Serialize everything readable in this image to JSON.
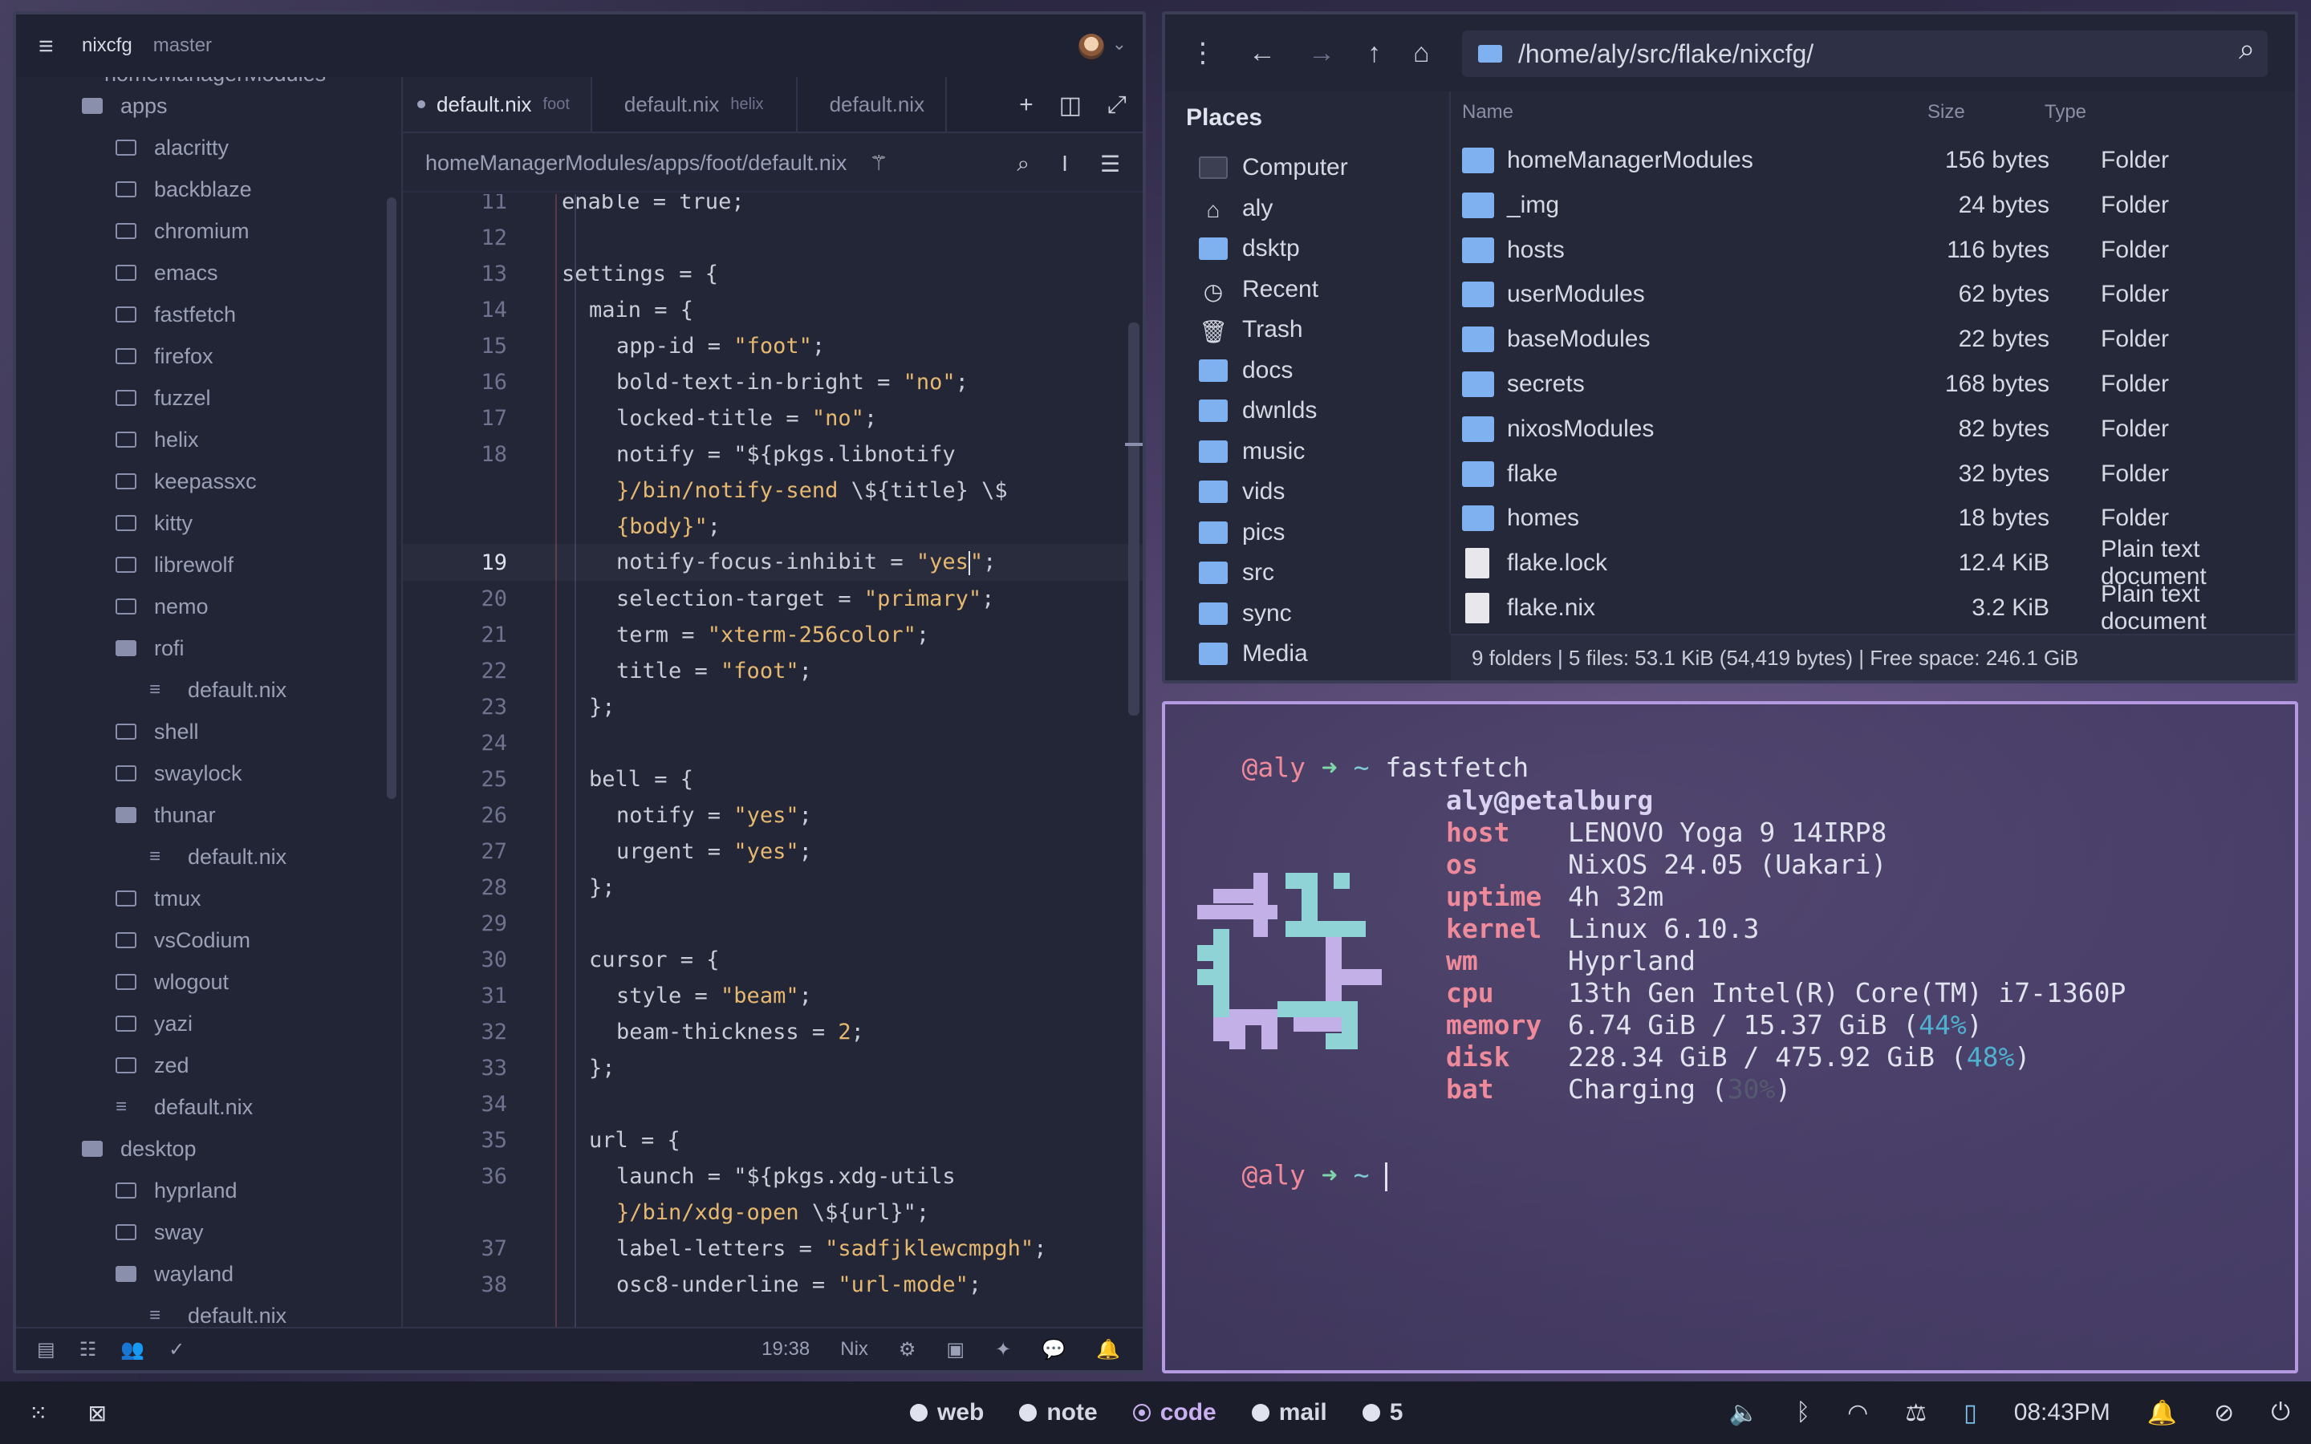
{
  "editor": {
    "project": "nixcfg",
    "branch": "master",
    "tabs": [
      {
        "label": "default.nix",
        "hint": "foot",
        "active": true
      },
      {
        "label": "default.nix",
        "hint": "helix",
        "active": false
      },
      {
        "label": "default.nix",
        "hint": "",
        "active": false
      }
    ],
    "breadcrumb": "homeManagerModules/apps/foot/default.nix",
    "sidebar": {
      "top_partial": "homeManagerModules",
      "items": [
        {
          "label": "apps",
          "kind": "folder-open",
          "depth": 1
        },
        {
          "label": "alacritty",
          "kind": "folder",
          "depth": 2
        },
        {
          "label": "backblaze",
          "kind": "folder",
          "depth": 2
        },
        {
          "label": "chromium",
          "kind": "folder",
          "depth": 2
        },
        {
          "label": "emacs",
          "kind": "folder",
          "depth": 2
        },
        {
          "label": "fastfetch",
          "kind": "folder",
          "depth": 2
        },
        {
          "label": "firefox",
          "kind": "folder",
          "depth": 2
        },
        {
          "label": "fuzzel",
          "kind": "folder",
          "depth": 2
        },
        {
          "label": "helix",
          "kind": "folder",
          "depth": 2
        },
        {
          "label": "keepassxc",
          "kind": "folder",
          "depth": 2
        },
        {
          "label": "kitty",
          "kind": "folder",
          "depth": 2
        },
        {
          "label": "librewolf",
          "kind": "folder",
          "depth": 2
        },
        {
          "label": "nemo",
          "kind": "folder",
          "depth": 2
        },
        {
          "label": "rofi",
          "kind": "folder-open",
          "depth": 2
        },
        {
          "label": "default.nix",
          "kind": "file",
          "depth": 3
        },
        {
          "label": "shell",
          "kind": "folder",
          "depth": 2
        },
        {
          "label": "swaylock",
          "kind": "folder",
          "depth": 2
        },
        {
          "label": "thunar",
          "kind": "folder-open",
          "depth": 2
        },
        {
          "label": "default.nix",
          "kind": "file",
          "depth": 3
        },
        {
          "label": "tmux",
          "kind": "folder",
          "depth": 2
        },
        {
          "label": "vsCodium",
          "kind": "folder",
          "depth": 2
        },
        {
          "label": "wlogout",
          "kind": "folder",
          "depth": 2
        },
        {
          "label": "yazi",
          "kind": "folder",
          "depth": 2
        },
        {
          "label": "zed",
          "kind": "folder",
          "depth": 2
        },
        {
          "label": "default.nix",
          "kind": "file",
          "depth": 2
        },
        {
          "label": "desktop",
          "kind": "folder-open",
          "depth": 1
        },
        {
          "label": "hyprland",
          "kind": "folder",
          "depth": 2
        },
        {
          "label": "sway",
          "kind": "folder",
          "depth": 2
        },
        {
          "label": "wayland",
          "kind": "folder-open",
          "depth": 2
        },
        {
          "label": "default.nix",
          "kind": "file",
          "depth": 3
        }
      ]
    },
    "code": [
      {
        "ln": "11",
        "text": "enable = true;",
        "indent": 2
      },
      {
        "ln": "12",
        "text": "",
        "indent": 0
      },
      {
        "ln": "13",
        "text": "settings = {",
        "indent": 2
      },
      {
        "ln": "14",
        "text": "main = {",
        "indent": 3
      },
      {
        "ln": "15",
        "parts": [
          [
            "app-id = ",
            ""
          ],
          [
            "\"foot\"",
            "str"
          ],
          [
            ";",
            ""
          ]
        ],
        "indent": 4
      },
      {
        "ln": "16",
        "parts": [
          [
            "bold-text-in-bright = ",
            ""
          ],
          [
            "\"no\"",
            "str"
          ],
          [
            ";",
            ""
          ]
        ],
        "indent": 4
      },
      {
        "ln": "17",
        "parts": [
          [
            "locked-title = ",
            ""
          ],
          [
            "\"no\"",
            "str"
          ],
          [
            ";",
            ""
          ]
        ],
        "indent": 4
      },
      {
        "ln": "18",
        "parts": [
          [
            "notify = \"${pkgs.libnotify",
            ""
          ]
        ],
        "indent": 4
      },
      {
        "ln": "",
        "parts": [
          [
            "}/bin/notify-send ",
            "str"
          ],
          [
            "\\${title} \\$",
            ""
          ]
        ],
        "indent": 4
      },
      {
        "ln": "",
        "parts": [
          [
            "{body}\"",
            "str"
          ],
          [
            ";",
            ""
          ]
        ],
        "indent": 4
      },
      {
        "ln": "19",
        "parts": [
          [
            "notify-focus-inhibit = ",
            ""
          ],
          [
            "\"yes",
            "str"
          ],
          [
            "|",
            "caret"
          ],
          [
            "\"",
            "str"
          ],
          [
            ";",
            ""
          ]
        ],
        "indent": 4,
        "current": true
      },
      {
        "ln": "20",
        "parts": [
          [
            "selection-target = ",
            ""
          ],
          [
            "\"primary\"",
            "str"
          ],
          [
            ";",
            ""
          ]
        ],
        "indent": 4
      },
      {
        "ln": "21",
        "parts": [
          [
            "term = ",
            ""
          ],
          [
            "\"xterm-256color\"",
            "str"
          ],
          [
            ";",
            ""
          ]
        ],
        "indent": 4
      },
      {
        "ln": "22",
        "parts": [
          [
            "title = ",
            ""
          ],
          [
            "\"foot\"",
            "str"
          ],
          [
            ";",
            ""
          ]
        ],
        "indent": 4
      },
      {
        "ln": "23",
        "text": "};",
        "indent": 3
      },
      {
        "ln": "24",
        "text": "",
        "indent": 0
      },
      {
        "ln": "25",
        "text": "bell = {",
        "indent": 3
      },
      {
        "ln": "26",
        "parts": [
          [
            "notify = ",
            ""
          ],
          [
            "\"yes\"",
            "str"
          ],
          [
            ";",
            ""
          ]
        ],
        "indent": 4
      },
      {
        "ln": "27",
        "parts": [
          [
            "urgent = ",
            ""
          ],
          [
            "\"yes\"",
            "str"
          ],
          [
            ";",
            ""
          ]
        ],
        "indent": 4
      },
      {
        "ln": "28",
        "text": "};",
        "indent": 3
      },
      {
        "ln": "29",
        "text": "",
        "indent": 0
      },
      {
        "ln": "30",
        "text": "cursor = {",
        "indent": 3
      },
      {
        "ln": "31",
        "parts": [
          [
            "style = ",
            ""
          ],
          [
            "\"beam\"",
            "str"
          ],
          [
            ";",
            ""
          ]
        ],
        "indent": 4
      },
      {
        "ln": "32",
        "parts": [
          [
            "beam-thickness = ",
            ""
          ],
          [
            "2",
            "num"
          ],
          [
            ";",
            ""
          ]
        ],
        "indent": 4
      },
      {
        "ln": "33",
        "text": "};",
        "indent": 3
      },
      {
        "ln": "34",
        "text": "",
        "indent": 0
      },
      {
        "ln": "35",
        "text": "url = {",
        "indent": 3
      },
      {
        "ln": "36",
        "parts": [
          [
            "launch = \"${pkgs.xdg-utils",
            ""
          ]
        ],
        "indent": 4
      },
      {
        "ln": "",
        "parts": [
          [
            "}/bin/xdg-open ",
            "str"
          ],
          [
            "\\${url}\"",
            ""
          ],
          [
            ";",
            ""
          ]
        ],
        "indent": 4
      },
      {
        "ln": "37",
        "parts": [
          [
            "label-letters = ",
            ""
          ],
          [
            "\"sadfjklewcmpgh\"",
            "str"
          ],
          [
            ";",
            ""
          ]
        ],
        "indent": 4
      },
      {
        "ln": "38",
        "parts": [
          [
            "osc8-underline = ",
            ""
          ],
          [
            "\"url-mode\"",
            "str"
          ],
          [
            ";",
            ""
          ]
        ],
        "indent": 4
      }
    ],
    "status": {
      "position": "19:38",
      "language": "Nix"
    }
  },
  "file_manager": {
    "path": "/home/aly/src/flake/nixcfg/",
    "places_title": "Places",
    "places": [
      {
        "label": "Computer",
        "icon": "computer-icon"
      },
      {
        "label": "aly",
        "icon": "home-icon"
      },
      {
        "label": "dsktp",
        "icon": "folder-icon"
      },
      {
        "label": "Recent",
        "icon": "recent-icon"
      },
      {
        "label": "Trash",
        "icon": "trash-icon"
      },
      {
        "label": "docs",
        "icon": "folder-icon"
      },
      {
        "label": "dwnlds",
        "icon": "folder-icon"
      },
      {
        "label": "music",
        "icon": "folder-icon"
      },
      {
        "label": "vids",
        "icon": "folder-icon"
      },
      {
        "label": "pics",
        "icon": "folder-icon"
      },
      {
        "label": "src",
        "icon": "folder-icon"
      },
      {
        "label": "sync",
        "icon": "folder-icon"
      },
      {
        "label": "Media",
        "icon": "folder-icon"
      }
    ],
    "columns": {
      "name": "Name",
      "size": "Size",
      "type": "Type"
    },
    "rows": [
      {
        "name": "homeManagerModules",
        "size": "156 bytes",
        "type": "Folder",
        "kind": "folder"
      },
      {
        "name": "_img",
        "size": "24 bytes",
        "type": "Folder",
        "kind": "folder"
      },
      {
        "name": "hosts",
        "size": "116 bytes",
        "type": "Folder",
        "kind": "folder"
      },
      {
        "name": "userModules",
        "size": "62 bytes",
        "type": "Folder",
        "kind": "folder"
      },
      {
        "name": "baseModules",
        "size": "22 bytes",
        "type": "Folder",
        "kind": "folder"
      },
      {
        "name": "secrets",
        "size": "168 bytes",
        "type": "Folder",
        "kind": "folder"
      },
      {
        "name": "nixosModules",
        "size": "82 bytes",
        "type": "Folder",
        "kind": "folder"
      },
      {
        "name": "flake",
        "size": "32 bytes",
        "type": "Folder",
        "kind": "folder"
      },
      {
        "name": "homes",
        "size": "18 bytes",
        "type": "Folder",
        "kind": "folder"
      },
      {
        "name": "flake.lock",
        "size": "12.4 KiB",
        "type": "Plain text document",
        "kind": "doc"
      },
      {
        "name": "flake.nix",
        "size": "3.2 KiB",
        "type": "Plain text document",
        "kind": "doc"
      }
    ],
    "status": "9 folders  |  5 files: 53.1 KiB (54,419 bytes)  |  Free space: 246.1 GiB"
  },
  "terminal": {
    "user": "@aly",
    "arrow": "➜",
    "tilde": "~",
    "command": "fastfetch",
    "userhost": "aly@petalburg",
    "info": [
      {
        "key": "host",
        "value": "LENOVO Yoga 9 14IRP8"
      },
      {
        "key": "os",
        "value": "NixOS 24.05 (Uakari)"
      },
      {
        "key": "uptime",
        "value": "4h 32m"
      },
      {
        "key": "kernel",
        "value": "Linux 6.10.3"
      },
      {
        "key": "wm",
        "value": "Hyprland"
      },
      {
        "key": "cpu",
        "value": "13th Gen Intel(R) Core(TM) i7-1360P"
      },
      {
        "key": "memory",
        "value": "6.74 GiB / 15.37 GiB (",
        "pct": "44%",
        "tail": ")"
      },
      {
        "key": "disk",
        "value": "228.34 GiB / 475.92 GiB (",
        "pct": "48%",
        "tail": ")"
      },
      {
        "key": "bat",
        "value": "Charging (",
        "pct_dim": "30%",
        "tail": ")"
      }
    ]
  },
  "taskbar": {
    "workspaces": [
      {
        "label": "web",
        "active": false
      },
      {
        "label": "note",
        "active": false
      },
      {
        "label": "code",
        "active": true
      },
      {
        "label": "mail",
        "active": false
      },
      {
        "label": "5",
        "active": false
      }
    ],
    "clock": "08:43PM"
  },
  "colors": {
    "accent": "#b49ae0",
    "string": "#e6b870",
    "folder": "#7fb0f0",
    "prompt_user": "#ef8a9a",
    "prompt_arrow": "#7fd6a8"
  }
}
